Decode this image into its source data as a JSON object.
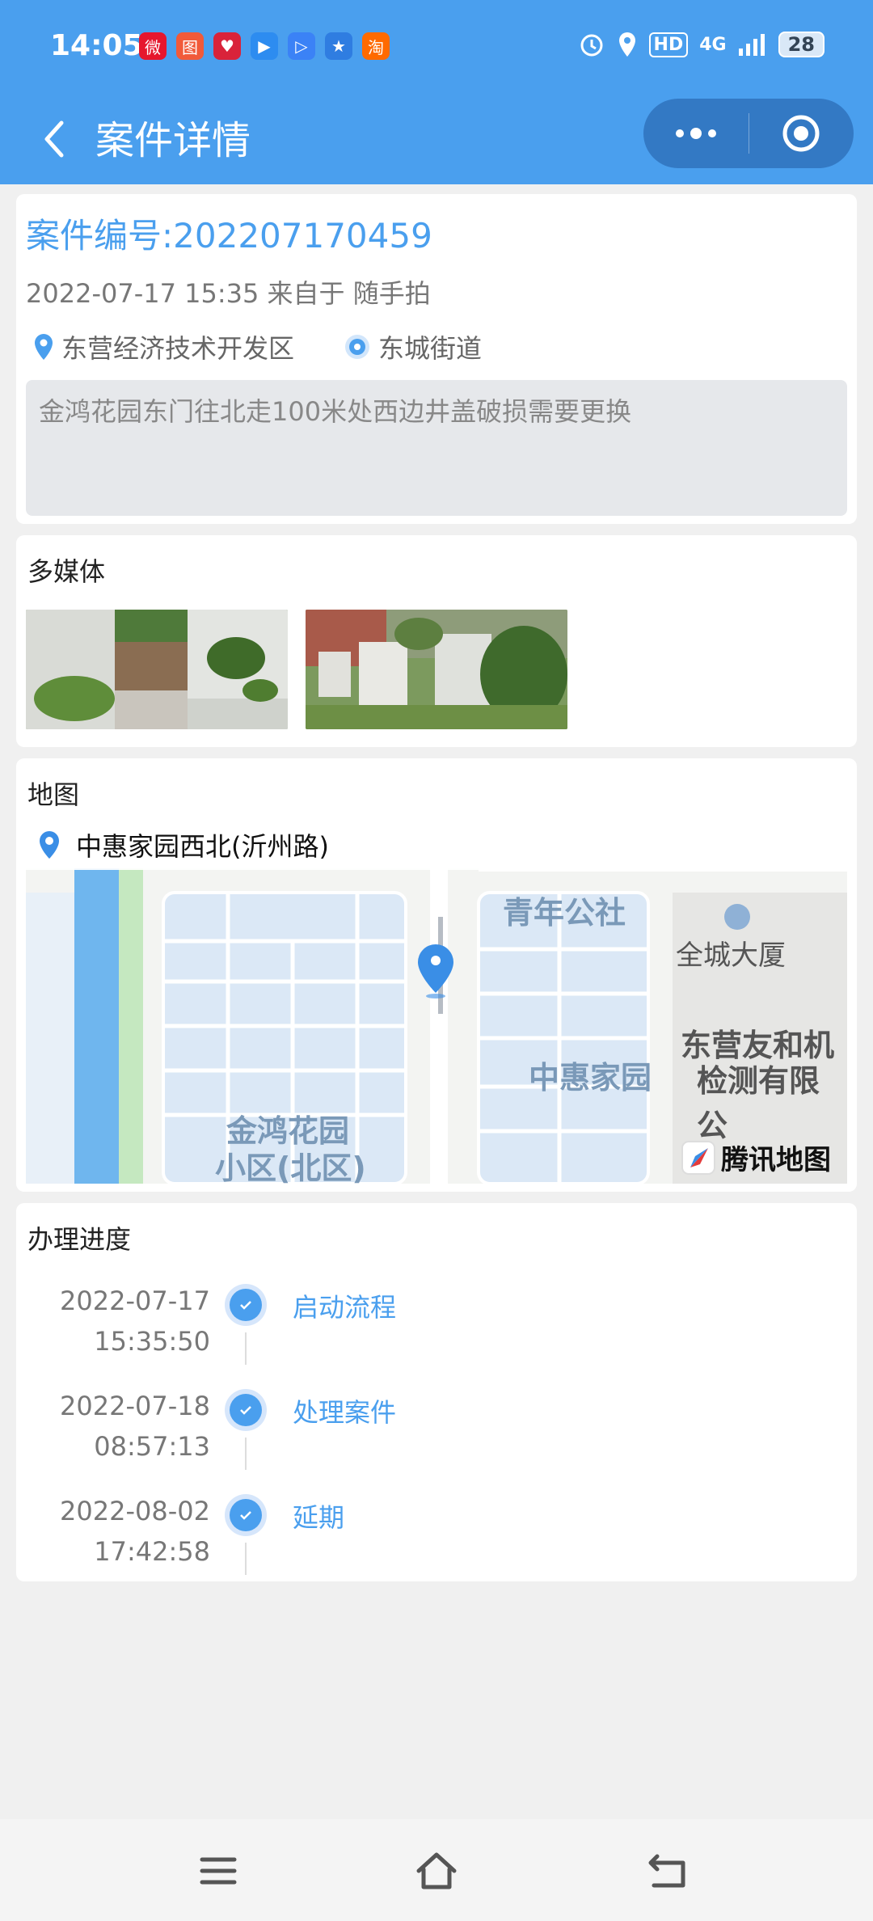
{
  "status_bar": {
    "time": "14:05",
    "network": "4G",
    "hd": "HD",
    "battery": "28",
    "app_icons": [
      {
        "name": "weibo-icon",
        "color": "#e6162d",
        "glyph": "微"
      },
      {
        "name": "map-app-icon",
        "color": "#f15a3a",
        "glyph": "图"
      },
      {
        "name": "heart-app-icon",
        "color": "#d9233a",
        "glyph": "♥"
      },
      {
        "name": "video-app-icon",
        "color": "#2d8cf0",
        "glyph": "▶"
      },
      {
        "name": "play-app-icon",
        "color": "#3b82f6",
        "glyph": "▷"
      },
      {
        "name": "star-app-icon",
        "color": "#2f7de1",
        "glyph": "★"
      },
      {
        "name": "taobao-icon",
        "color": "#ff6a00",
        "glyph": "淘"
      }
    ]
  },
  "header": {
    "title": "案件详情"
  },
  "case": {
    "number": "案件编号:202207170459",
    "meta": "2022-07-17 15:35 来自于 随手拍",
    "district": "东营经济技术开发区",
    "street": "东城街道",
    "description": "金鸿花园东门往北走100米处西边井盖破损需要更换"
  },
  "media": {
    "title": "多媒体"
  },
  "map": {
    "title": "地图",
    "address": "中惠家园西北(沂州路)",
    "labels": {
      "qingnian": "青年公社",
      "quancheng": "全城大厦",
      "zhonghui": "中惠家园",
      "jinhong_1": "金鸿花园",
      "jinhong_2": "小区(北区)",
      "youhe_1": "东营友和机",
      "youhe_2": "检测有限公"
    },
    "provider": "腾讯地图"
  },
  "progress": {
    "title": "办理进度",
    "steps": [
      {
        "date": "2022-07-17",
        "time": "15:35:50",
        "name": "启动流程"
      },
      {
        "date": "2022-07-18",
        "time": "08:57:13",
        "name": "处理案件"
      },
      {
        "date": "2022-08-02",
        "time": "17:42:58",
        "name": "延期"
      }
    ]
  },
  "colors": {
    "primary": "#4a9fee",
    "header_bg": "#4a9fee",
    "capsule_bg": "#3379c4"
  }
}
